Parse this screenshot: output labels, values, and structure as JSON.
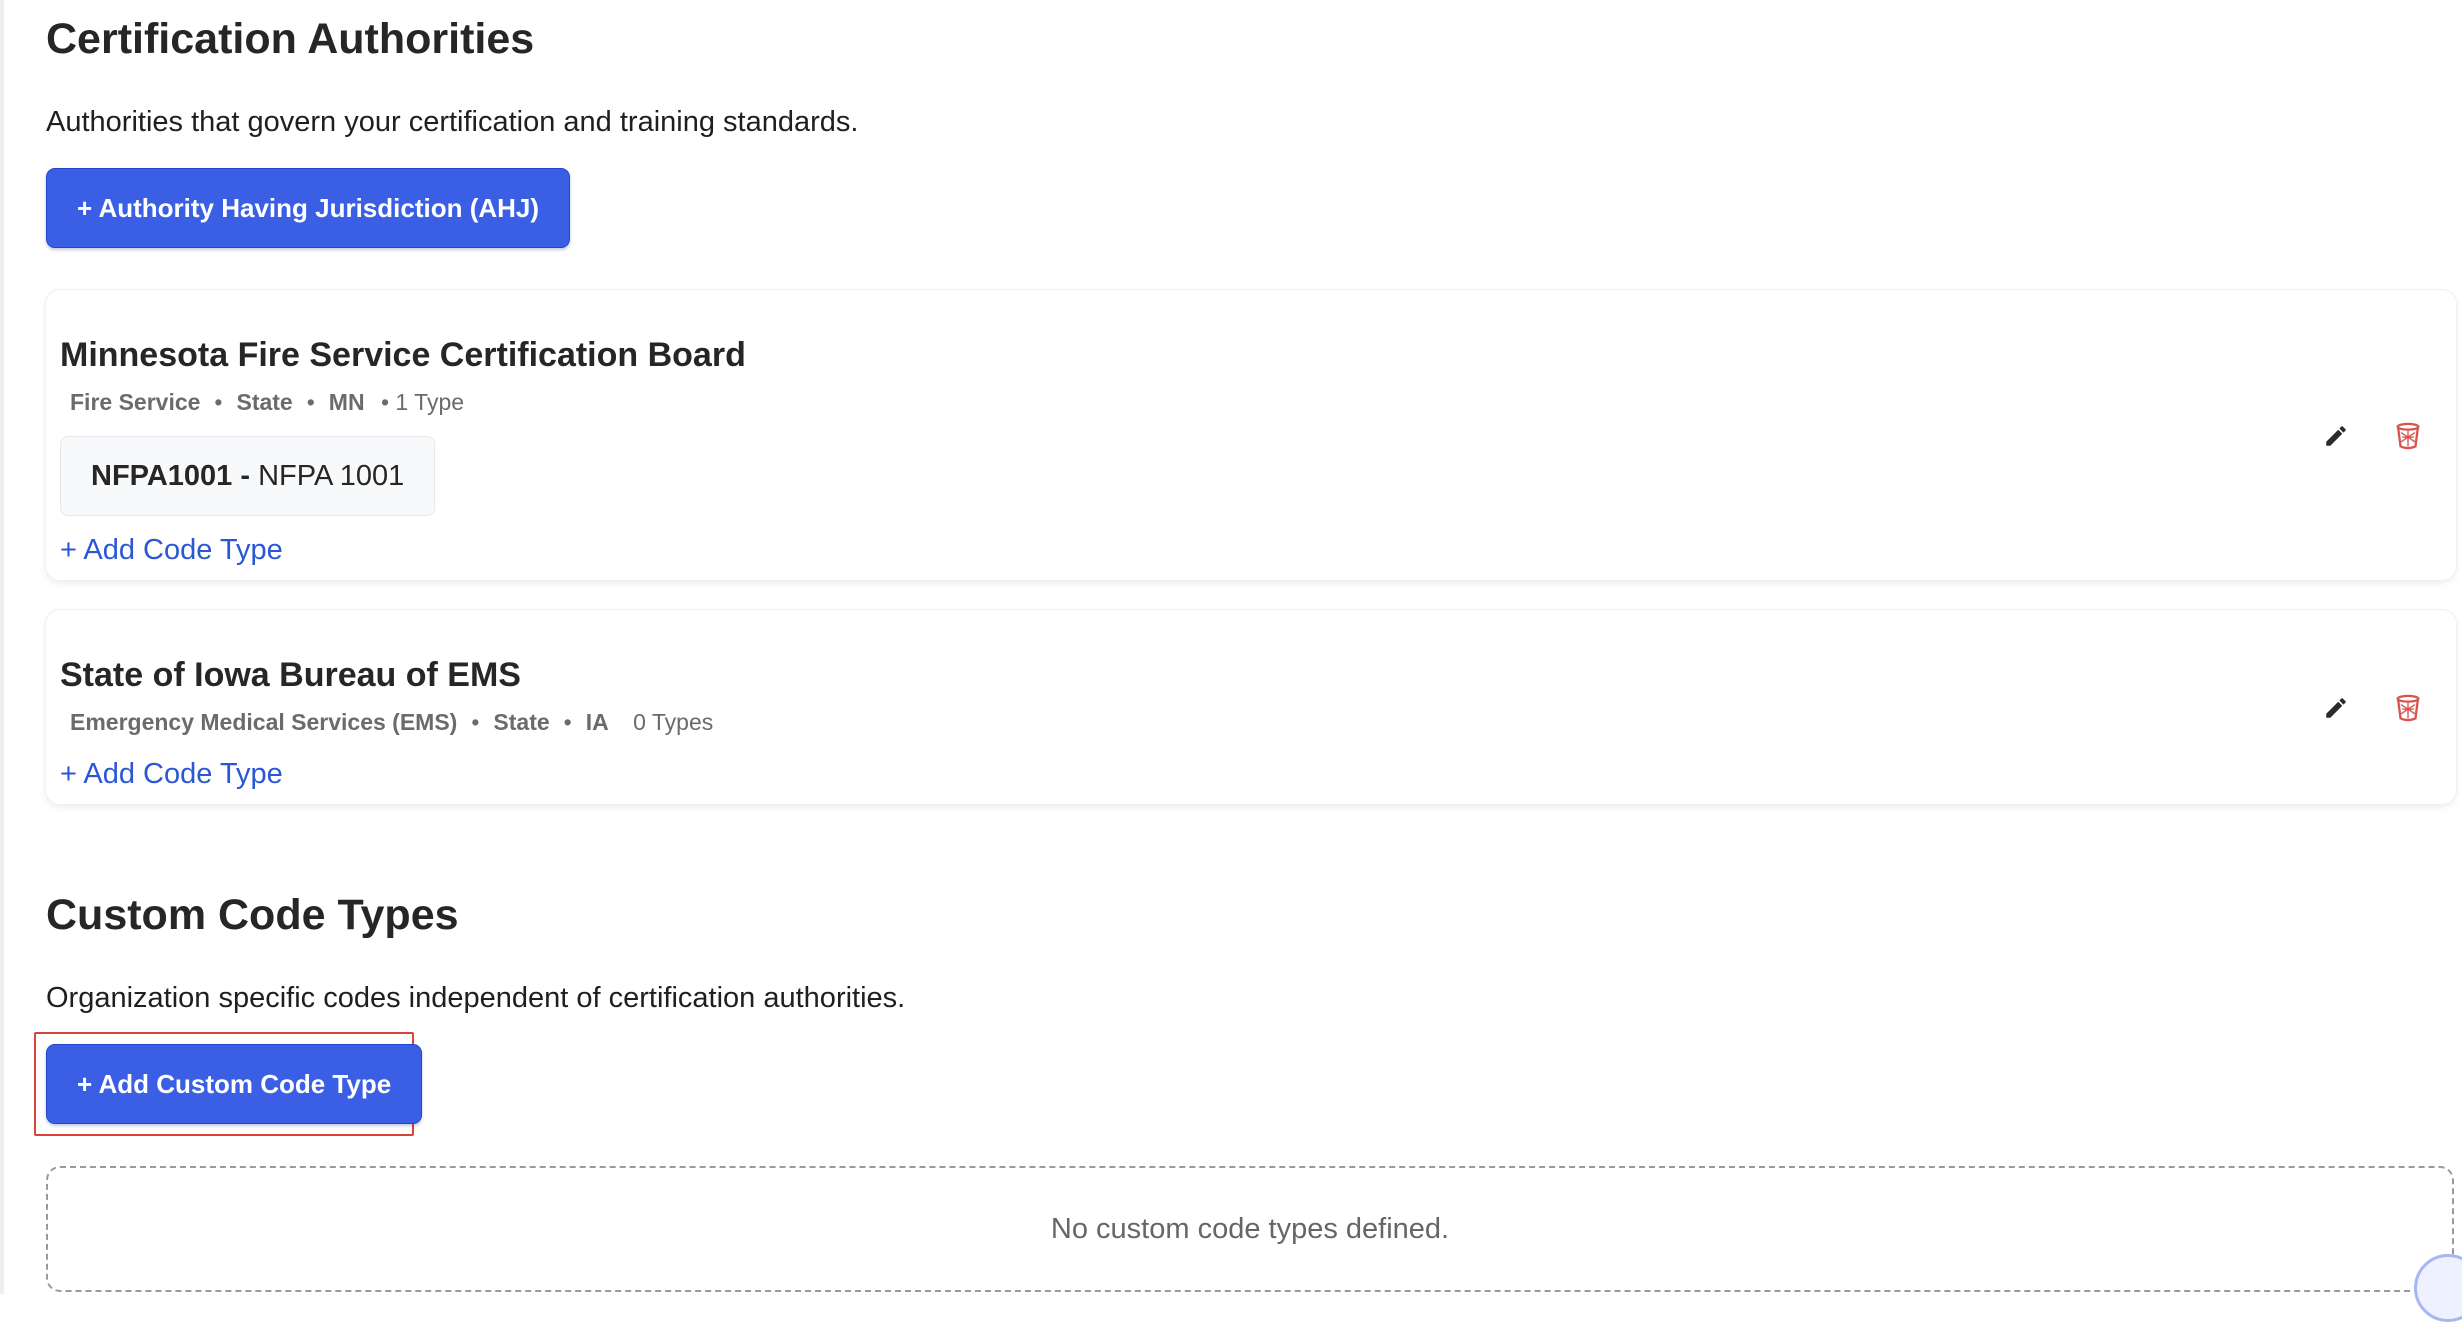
{
  "certification_authorities": {
    "title": "Certification Authorities",
    "description": "Authorities that govern your certification and training standards.",
    "add_button": "+ Authority Having Jurisdiction (AHJ)",
    "authorities": [
      {
        "name": "Minnesota Fire Service Certification Board",
        "category": "Fire Service",
        "level": "State",
        "region": "MN",
        "type_count": "• 1 Type",
        "code_types": [
          {
            "code": "NFPA1001 -",
            "label": "NFPA 1001"
          }
        ],
        "add_code_type": "+ Add Code Type"
      },
      {
        "name": "State of Iowa Bureau of EMS",
        "category": "Emergency Medical Services (EMS)",
        "level": "State",
        "region": "IA",
        "type_count": "0 Types",
        "code_types": [],
        "add_code_type": "+ Add Code Type"
      }
    ]
  },
  "custom_code_types": {
    "title": "Custom Code Types",
    "description": "Organization specific codes independent of certification authorities.",
    "add_button": "+ Add Custom Code Type",
    "empty_message": "No custom code types defined."
  },
  "separator": "•",
  "icons": {
    "edit": "pencil-icon",
    "delete": "trash-icon"
  },
  "colors": {
    "primary": "#3a5fe5",
    "link": "#2a57d6",
    "danger": "#d9534f",
    "highlight": "#d9423a"
  }
}
